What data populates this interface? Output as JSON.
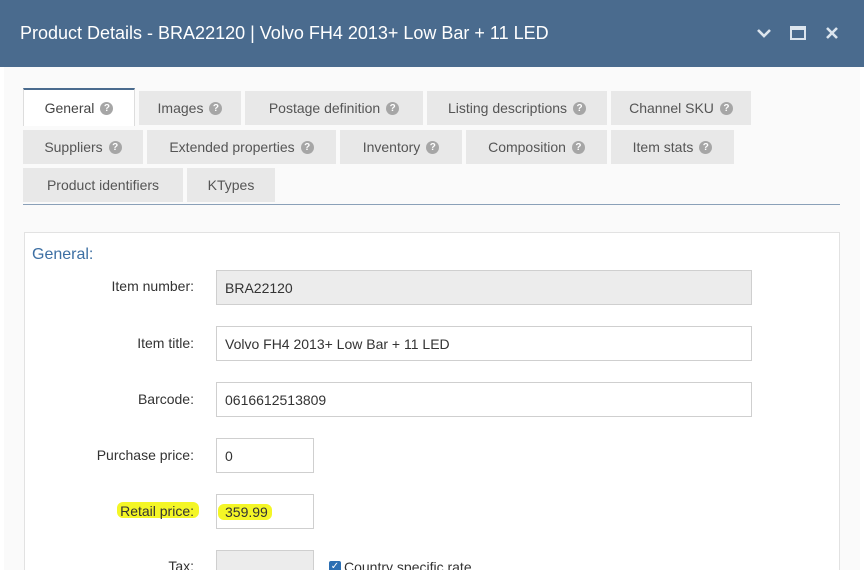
{
  "window": {
    "title": "Product Details - BRA22120 | Volvo FH4 2013+ Low Bar + 11 LED"
  },
  "tabs": [
    {
      "label": "General",
      "help": "?"
    },
    {
      "label": "Images",
      "help": "?"
    },
    {
      "label": "Postage definition",
      "help": "?"
    },
    {
      "label": "Listing descriptions",
      "help": "?"
    },
    {
      "label": "Channel SKU",
      "help": "?"
    },
    {
      "label": "Suppliers",
      "help": "?"
    },
    {
      "label": "Extended properties",
      "help": "?"
    },
    {
      "label": "Inventory",
      "help": "?"
    },
    {
      "label": "Composition",
      "help": "?"
    },
    {
      "label": "Item stats",
      "help": "?"
    },
    {
      "label": "Product identifiers"
    },
    {
      "label": "KTypes"
    }
  ],
  "general": {
    "section_title": "General:",
    "fields": {
      "item_number": {
        "label": "Item number:",
        "value": "BRA22120"
      },
      "item_title": {
        "label": "Item title:",
        "value": "Volvo FH4 2013+ Low Bar + 11 LED"
      },
      "barcode": {
        "label": "Barcode:",
        "value": "0616612513809"
      },
      "purchase_price": {
        "label": "Purchase price:",
        "value": "0"
      },
      "retail_price": {
        "label": "Retail price:",
        "value": "359.99"
      },
      "tax": {
        "label": "Tax:",
        "value": ""
      }
    },
    "country_specific_rate": {
      "label": "Country specific rate",
      "checked": true
    }
  },
  "colors": {
    "titlebar": "#4a6b8e",
    "accent": "#3d6fa3",
    "highlight": "#f3f51a"
  }
}
